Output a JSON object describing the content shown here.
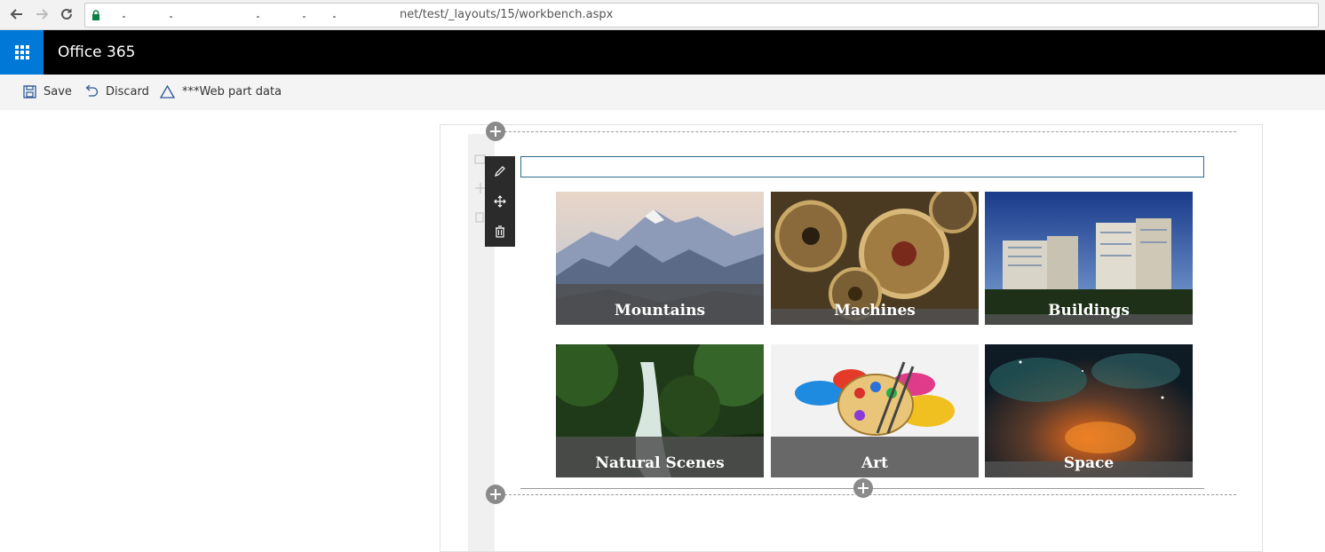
{
  "browser": {
    "url_text": "net/test/_layouts/15/workbench.aspx",
    "back_icon": "arrow-left-icon",
    "forward_icon": "arrow-right-icon",
    "reload_icon": "reload-icon",
    "lock_icon": "lock-icon"
  },
  "suite_bar": {
    "title": "Office 365",
    "launcher_icon": "waffle-icon",
    "accent_color": "#0078d7"
  },
  "command_bar": {
    "save_label": "Save",
    "discard_label": "Discard",
    "webpart_data_label": "***Web part data"
  },
  "webpart": {
    "title_value": "",
    "tiles": [
      {
        "label": "Mountains"
      },
      {
        "label": "Machines"
      },
      {
        "label": "Buildings"
      },
      {
        "label": "Natural Scenes"
      },
      {
        "label": "Art"
      },
      {
        "label": "Space"
      }
    ],
    "toolbar": [
      "edit-icon",
      "move-icon",
      "delete-icon"
    ]
  }
}
